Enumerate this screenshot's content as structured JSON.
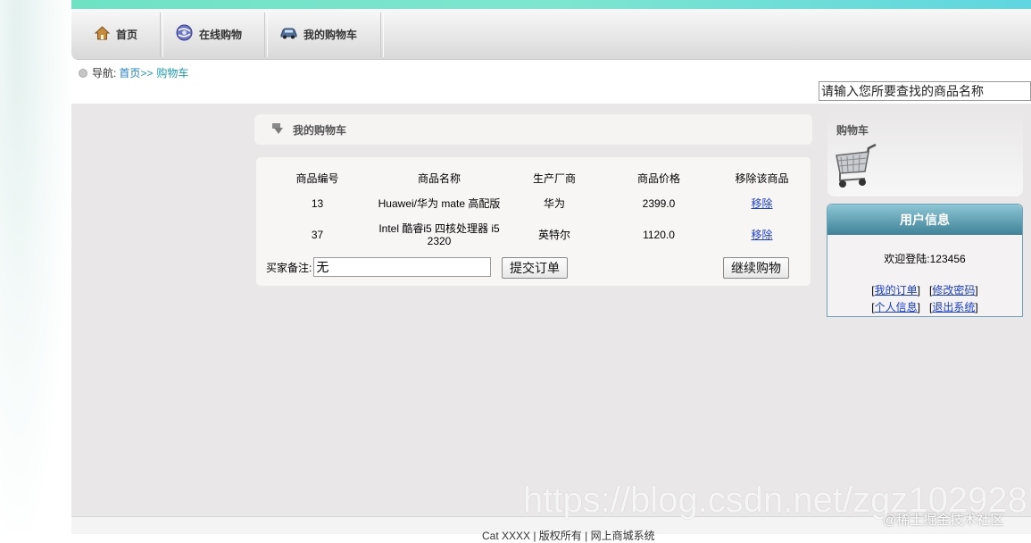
{
  "nav": {
    "items": [
      {
        "label": "首页",
        "icon": "home-icon"
      },
      {
        "label": "在线购物",
        "icon": "globe-icon"
      },
      {
        "label": "我的购物车",
        "icon": "car-icon"
      }
    ]
  },
  "breadcrumb": {
    "prefix": "导航:",
    "home_link": "首页",
    "separator": ">>",
    "current": "购物车"
  },
  "search": {
    "value": "请输入您所要查找的商品名称"
  },
  "cart": {
    "title": "我的购物车",
    "columns": [
      "商品编号",
      "商品名称",
      "生产厂商",
      "商品价格",
      "移除该商品"
    ],
    "rows": [
      {
        "id": "13",
        "name": "Huawei/华为 mate 高配版",
        "maker": "华为",
        "price": "2399.0",
        "action": "移除"
      },
      {
        "id": "37",
        "name": "Intel 酷睿i5 四核处理器 i5 2320",
        "maker": "英特尔",
        "price": "1120.0",
        "action": "移除"
      }
    ],
    "remark_label": "买家备注:",
    "remark_value": "无",
    "submit_label": "提交订单",
    "continue_label": "继续购物"
  },
  "sidebar": {
    "cart_title": "购物车",
    "user_title": "用户信息",
    "welcome": "欢迎登陆:123456",
    "links": [
      "我的订单",
      "修改密码",
      "个人信息",
      "退出系统"
    ]
  },
  "footer": {
    "text": "Cat XXXX | 版权所有 | 网上商城系统"
  },
  "watermark": {
    "url": "https://blog.csdn.net/zgz102928",
    "site": "@稀土掘金技术社区"
  }
}
